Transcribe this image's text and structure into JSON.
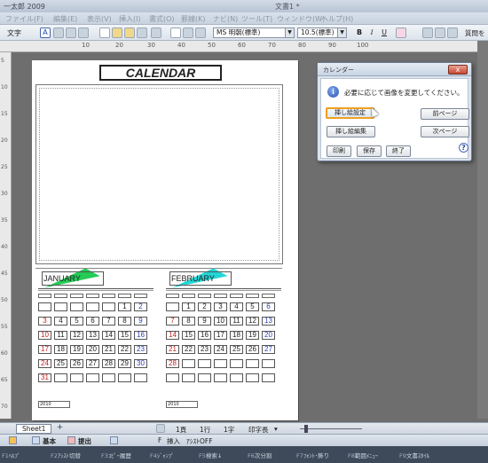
{
  "window": {
    "app_title": "一太郎 2009",
    "doc_title": "文書1 *"
  },
  "menu": [
    "ファイル(F)",
    "編集(E)",
    "表示(V)",
    "挿入(I)",
    "書式(O)",
    "罫線(K)",
    "ナビ(N)",
    "ツール(T)",
    "ウィンドウ(W)",
    "ヘルプ(H)"
  ],
  "toolbar": {
    "style_label": "文字",
    "font_value": "MS 明朝(標準)",
    "size_value": "10.5(標準)",
    "bold": "B",
    "italic": "I",
    "underline": "U",
    "right_label": "質問を"
  },
  "ruler": {
    "h_ticks": [
      "10",
      "20",
      "30",
      "40",
      "50",
      "60",
      "70",
      "80",
      "90",
      "100"
    ],
    "v_ticks": [
      "5",
      "10",
      "15",
      "20",
      "25",
      "30",
      "35",
      "40",
      "45",
      "50",
      "55",
      "60",
      "65",
      "70"
    ]
  },
  "document": {
    "title": "CALENDAR",
    "months": [
      {
        "label": "JANUARY",
        "year_label": "2010",
        "accent_color": "#22cc55",
        "rows": [
          [
            "",
            "",
            "",
            "",
            "",
            "1",
            "2"
          ],
          [
            "3",
            "4",
            "5",
            "6",
            "7",
            "8",
            "9"
          ],
          [
            "10",
            "11",
            "12",
            "13",
            "14",
            "15",
            "16"
          ],
          [
            "17",
            "18",
            "19",
            "20",
            "21",
            "22",
            "23"
          ],
          [
            "24",
            "25",
            "26",
            "27",
            "28",
            "29",
            "30"
          ],
          [
            "31",
            "",
            "",
            "",
            "",
            "",
            ""
          ]
        ]
      },
      {
        "label": "FEBRUARY",
        "year_label": "2010",
        "accent_color": "#22d6d6",
        "rows": [
          [
            "",
            "1",
            "2",
            "3",
            "4",
            "5",
            "6"
          ],
          [
            "7",
            "8",
            "9",
            "10",
            "11",
            "12",
            "13"
          ],
          [
            "14",
            "15",
            "16",
            "17",
            "18",
            "19",
            "20"
          ],
          [
            "21",
            "22",
            "23",
            "24",
            "25",
            "26",
            "27"
          ],
          [
            "28",
            "",
            "",
            "",
            "",
            "",
            ""
          ],
          [
            "",
            "",
            "",
            "",
            "",
            "",
            ""
          ]
        ]
      }
    ]
  },
  "dialog": {
    "title": "カレンダー",
    "close": "x",
    "message": "必要に応じて画像を変更してください。",
    "buttons": {
      "insert_settings": "挿し絵設定",
      "edit": "挿し絵編集",
      "prev": "前ページ",
      "next": "次ページ",
      "print": "印刷",
      "save": "保存",
      "finish": "終了"
    },
    "help": "?"
  },
  "statusbar": {
    "sheet": "Sheet1",
    "add": "+",
    "page": "1頁",
    "line": "1行",
    "col": "1字",
    "mode": "印字長",
    "arrow": "▾"
  },
  "modebar": {
    "basic": "基本",
    "submit": "提出",
    "insert": "挿入",
    "assist": "ｱｼｽﾄOFF",
    "f_label": "F"
  },
  "fkeys": [
    {
      "key": "F1",
      "label": "ﾍﾙﾌﾟ"
    },
    {
      "key": "F2",
      "label": "ｱｼｽﾄ切替"
    },
    {
      "key": "F3",
      "label": "ｺﾋﾟｰ履歴"
    },
    {
      "key": "F4",
      "label": "ｼﾞｬﾝﾌﾟ"
    },
    {
      "key": "F5",
      "label": "検索↓"
    },
    {
      "key": "F6",
      "label": "次分割"
    },
    {
      "key": "F7",
      "label": "ﾌｫﾝﾄ･飾り"
    },
    {
      "key": "F8",
      "label": "範囲ﾒﾆｭｰ"
    },
    {
      "key": "F9",
      "label": "文書ｽﾀｲﾙ"
    }
  ]
}
